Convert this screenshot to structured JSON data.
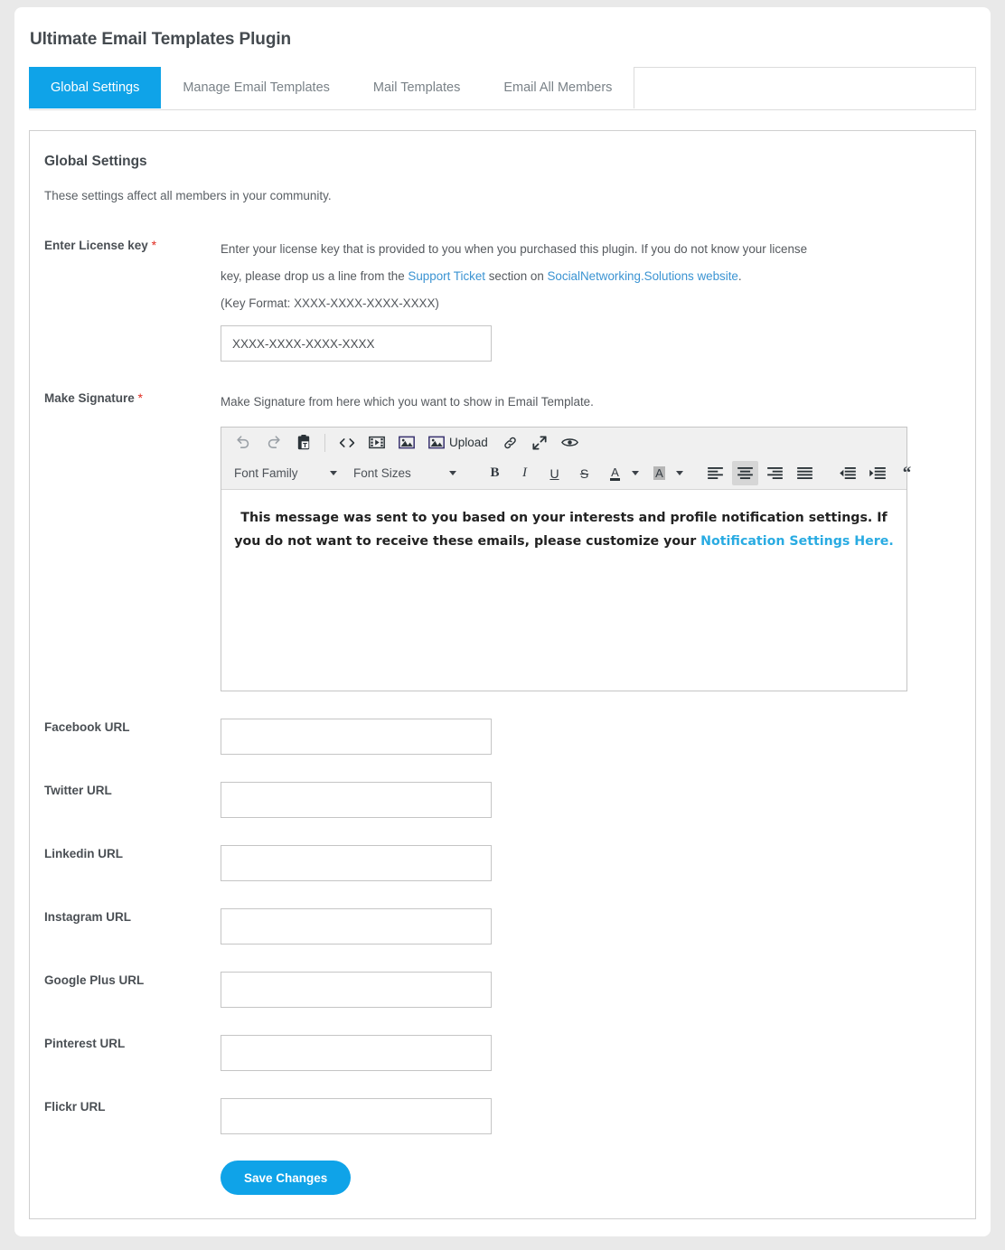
{
  "page": {
    "title": "Ultimate Email Templates Plugin"
  },
  "tabs": [
    {
      "label": "Global Settings",
      "active": true
    },
    {
      "label": "Manage Email Templates",
      "active": false
    },
    {
      "label": "Mail Templates",
      "active": false
    },
    {
      "label": "Email All Members",
      "active": false
    }
  ],
  "panel": {
    "title": "Global Settings",
    "subtitle": "These settings affect all members in your community."
  },
  "license": {
    "label": "Enter License key",
    "required_marker": "*",
    "desc_part1": "Enter your license key that is provided to you when you purchased this plugin. If you do not know your license key, please drop us a line from the ",
    "link_support": "Support Ticket",
    "desc_part2": " section on ",
    "link_site": "SocialNetworking.Solutions website",
    "desc_part3": ".",
    "key_format": "(Key Format: XXXX-XXXX-XXXX-XXXX)",
    "input_value": "XXXX-XXXX-XXXX-XXXX",
    "input_placeholder": "XXXX-XXXX-XXXX-XXXX"
  },
  "signature": {
    "label": "Make Signature",
    "required_marker": "*",
    "description": "Make Signature from here which you want to show in Email Template.",
    "toolbar_row1": [
      {
        "name": "undo-icon",
        "label": ""
      },
      {
        "name": "redo-icon",
        "label": ""
      },
      {
        "name": "paste-as-text-icon",
        "label": ""
      },
      {
        "name": "source-code-icon",
        "label": ""
      },
      {
        "name": "insert-media-icon",
        "label": ""
      },
      {
        "name": "insert-image-icon",
        "label": ""
      },
      {
        "name": "upload-image-icon",
        "label": "Upload"
      },
      {
        "name": "insert-link-icon",
        "label": ""
      },
      {
        "name": "fullscreen-icon",
        "label": ""
      },
      {
        "name": "preview-icon",
        "label": ""
      }
    ],
    "font_family_label": "Font Family",
    "font_sizes_label": "Font Sizes",
    "toolbar_row2": [
      {
        "name": "bold-icon",
        "label": "B"
      },
      {
        "name": "italic-icon",
        "label": "I"
      },
      {
        "name": "underline-icon",
        "label": "U"
      },
      {
        "name": "strikethrough-icon",
        "label": "S"
      },
      {
        "name": "text-color-icon",
        "label": "A"
      },
      {
        "name": "background-color-icon",
        "label": "A"
      },
      {
        "name": "align-left-icon",
        "label": ""
      },
      {
        "name": "align-center-icon",
        "label": ""
      },
      {
        "name": "align-right-icon",
        "label": ""
      },
      {
        "name": "align-justify-icon",
        "label": ""
      },
      {
        "name": "outdent-icon",
        "label": ""
      },
      {
        "name": "indent-icon",
        "label": ""
      },
      {
        "name": "blockquote-icon",
        "label": "“"
      }
    ],
    "active_alignment": "align-center-icon",
    "content_text": "This message was sent to you based on your interests and profile notification settings. If you do not want to receive these emails, please customize your ",
    "content_link": "Notification Settings Here."
  },
  "urls": [
    {
      "label": "Facebook URL",
      "value": "",
      "name": "facebook-url-input"
    },
    {
      "label": "Twitter URL",
      "value": "",
      "name": "twitter-url-input"
    },
    {
      "label": "Linkedin URL",
      "value": "",
      "name": "linkedin-url-input"
    },
    {
      "label": "Instagram URL",
      "value": "",
      "name": "instagram-url-input"
    },
    {
      "label": "Google Plus URL",
      "value": "",
      "name": "google-plus-url-input"
    },
    {
      "label": "Pinterest URL",
      "value": "",
      "name": "pinterest-url-input"
    },
    {
      "label": "Flickr URL",
      "value": "",
      "name": "flickr-url-input"
    }
  ],
  "actions": {
    "save_label": "Save Changes"
  },
  "colors": {
    "accent": "#0fa3e8",
    "link": "#3a93d2",
    "signature_link": "#29abe2",
    "required": "#e02b20",
    "page_bg": "#e9e9e9",
    "panel_border": "#cfcfcf"
  }
}
